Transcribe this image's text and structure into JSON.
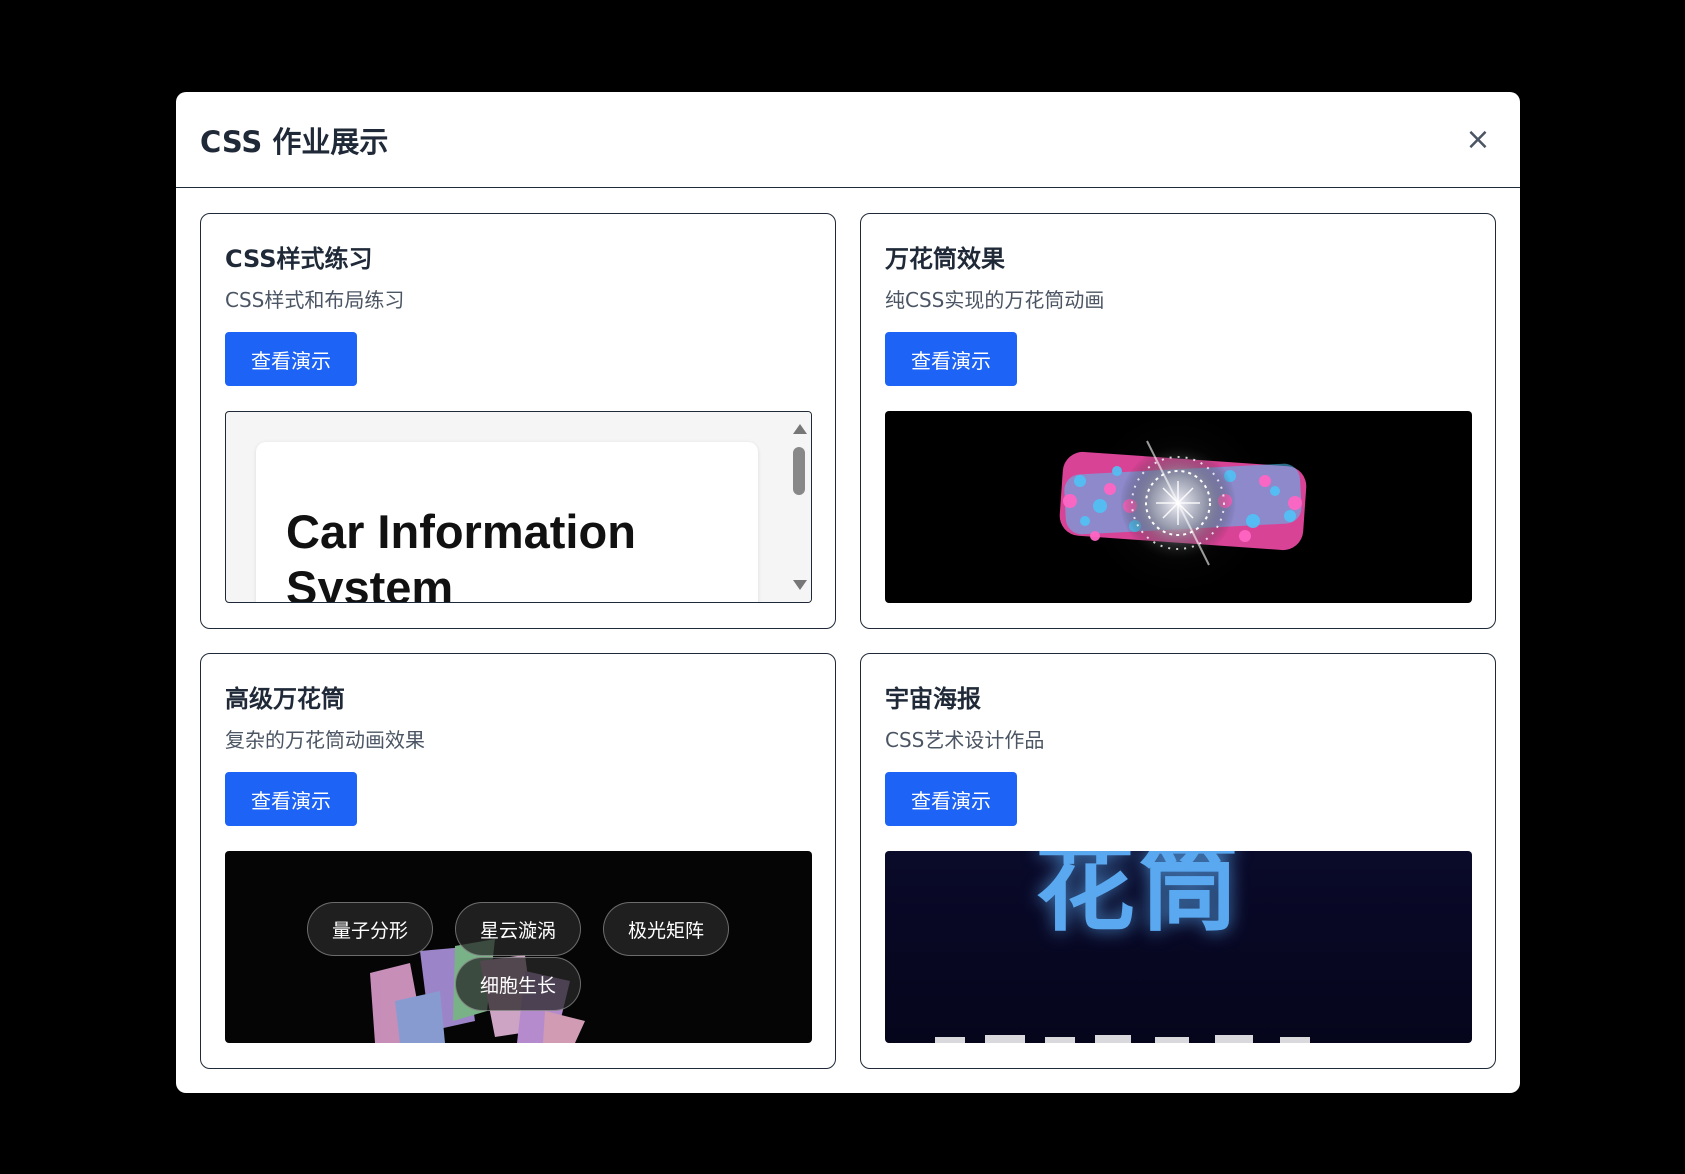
{
  "modal": {
    "title": "CSS 作业展示",
    "close_label": "×"
  },
  "cards": [
    {
      "title": "CSS样式练习",
      "description": "CSS样式和布局练习",
      "button_label": "查看演示",
      "preview": {
        "type": "page-preview",
        "heading": "Car Information System"
      }
    },
    {
      "title": "万花筒效果",
      "description": "纯CSS实现的万花筒动画",
      "button_label": "查看演示",
      "preview": {
        "type": "kaleidoscope-animation"
      }
    },
    {
      "title": "高级万花筒",
      "description": "复杂的万花筒动画效果",
      "button_label": "查看演示",
      "preview": {
        "type": "advanced-kaleidoscope",
        "pills": [
          "量子分形",
          "星云漩涡",
          "极光矩阵",
          "细胞生长"
        ]
      }
    },
    {
      "title": "宇宙海报",
      "description": "CSS艺术设计作品",
      "button_label": "查看演示",
      "preview": {
        "type": "poster",
        "glow_text": "花筒"
      }
    }
  ],
  "colors": {
    "backdrop": "#000000",
    "accent": "#1d63f5",
    "title": "#1f2937",
    "muted": "#4b5563"
  }
}
